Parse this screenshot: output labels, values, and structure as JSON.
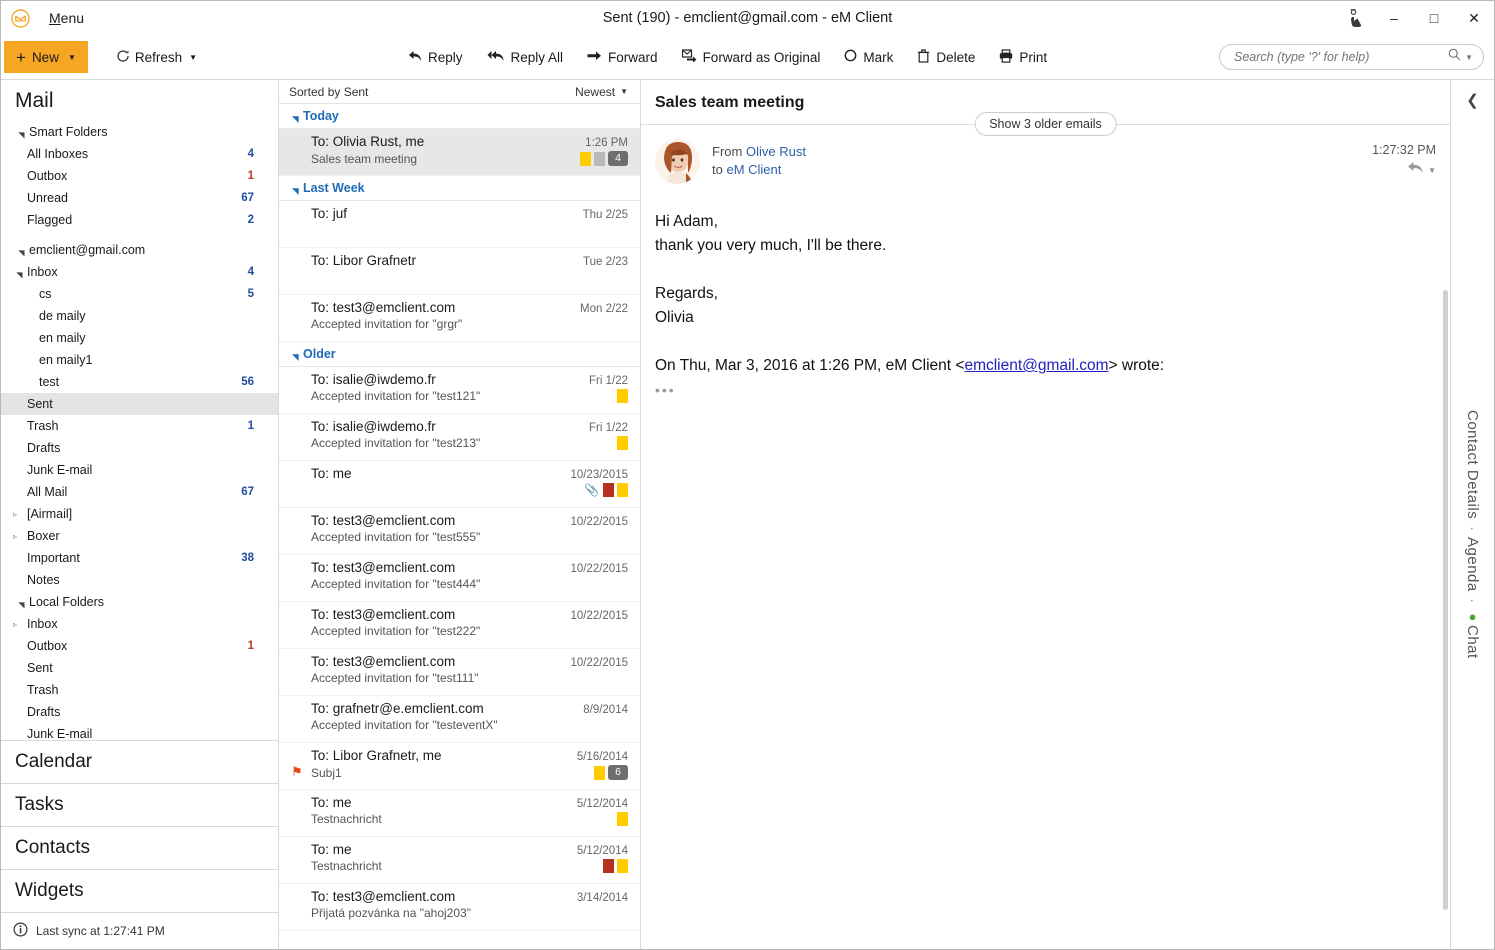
{
  "window": {
    "title": "Sent (190) - emclient@gmail.com - eM Client",
    "menu_label": "Menu",
    "logo_icon": "envelope-icon",
    "touch_icon": "touch-pointer-icon",
    "minimize_label": "–",
    "maximize_label": "□",
    "close_label": "✕"
  },
  "toolbar": {
    "new_label": "New",
    "refresh_label": "Refresh",
    "actions": [
      {
        "label": "Reply",
        "icon": "reply-arrow-icon"
      },
      {
        "label": "Reply All",
        "icon": "reply-all-arrow-icon"
      },
      {
        "label": "Forward",
        "icon": "forward-arrow-icon"
      },
      {
        "label": "Forward as Original",
        "icon": "forward-original-icon"
      },
      {
        "label": "Mark",
        "icon": "mark-circle-icon"
      },
      {
        "label": "Delete",
        "icon": "trash-icon"
      },
      {
        "label": "Print",
        "icon": "printer-icon"
      }
    ],
    "search": {
      "placeholder": "Search (type '?' for help)",
      "value": "",
      "icon": "search-icon",
      "dropdown_icon": "chevron-down-icon"
    }
  },
  "sidebar": {
    "title": "Mail",
    "groups": [
      {
        "label": "Smart Folders",
        "expanded": true,
        "items": [
          {
            "label": "All Inboxes",
            "count": "4",
            "indent": 1
          },
          {
            "label": "Outbox",
            "count": "1",
            "count_color": "red",
            "indent": 1
          },
          {
            "label": "Unread",
            "count": "67",
            "indent": 1
          },
          {
            "label": "Flagged",
            "count": "2",
            "indent": 1
          }
        ]
      },
      {
        "label": "emclient@gmail.com",
        "expanded": true,
        "items": [
          {
            "label": "Inbox",
            "count": "4",
            "indent": 1,
            "tri": "expanded"
          },
          {
            "label": "cs",
            "count": "5",
            "indent": 2
          },
          {
            "label": "de maily",
            "count": "",
            "indent": 2
          },
          {
            "label": "en maily",
            "count": "",
            "indent": 2
          },
          {
            "label": "en maily1",
            "count": "",
            "indent": 2
          },
          {
            "label": "test",
            "count": "56",
            "indent": 2
          },
          {
            "label": "Sent",
            "count": "",
            "indent": 1,
            "selected": true
          },
          {
            "label": "Trash",
            "count": "1",
            "indent": 1
          },
          {
            "label": "Drafts",
            "count": "",
            "indent": 1
          },
          {
            "label": "Junk E-mail",
            "count": "",
            "indent": 1
          },
          {
            "label": "All Mail",
            "count": "67",
            "indent": 1
          },
          {
            "label": "[Airmail]",
            "count": "",
            "indent": 1,
            "tri": "collapsed"
          },
          {
            "label": "Boxer",
            "count": "",
            "indent": 1,
            "tri": "collapsed"
          },
          {
            "label": "Important",
            "count": "38",
            "indent": 1
          },
          {
            "label": "Notes",
            "count": "",
            "indent": 1
          }
        ]
      },
      {
        "label": "Local Folders",
        "expanded": true,
        "items": [
          {
            "label": "Inbox",
            "count": "",
            "indent": 1,
            "tri": "collapsed"
          },
          {
            "label": "Outbox",
            "count": "1",
            "count_color": "red",
            "indent": 1
          },
          {
            "label": "Sent",
            "count": "",
            "indent": 1
          },
          {
            "label": "Trash",
            "count": "",
            "indent": 1
          },
          {
            "label": "Drafts",
            "count": "",
            "indent": 1
          },
          {
            "label": "Junk E-mail",
            "count": "",
            "indent": 1
          }
        ]
      }
    ],
    "nav": [
      {
        "label": "Calendar"
      },
      {
        "label": "Tasks"
      },
      {
        "label": "Contacts"
      },
      {
        "label": "Widgets"
      }
    ],
    "status": {
      "icon": "info-icon",
      "text": "Last sync at 1:27:41 PM"
    }
  },
  "msglist": {
    "sorted_by": "Sorted by Sent",
    "order": "Newest",
    "order_icon": "chevron-down-icon",
    "groups": [
      {
        "label": "Today",
        "messages": [
          {
            "to": "To: Olivia Rust, me",
            "date": "1:26 PM",
            "subject": "Sales team meeting",
            "selected": true,
            "swatches": [
              "#ffcc00",
              "#b9b9b9"
            ],
            "badge": "4"
          }
        ]
      },
      {
        "label": "Last Week",
        "messages": [
          {
            "to": "To: juf",
            "date": "Thu 2/25",
            "subject": ""
          },
          {
            "to": "To: Libor Grafnetr",
            "date": "Tue 2/23",
            "subject": ""
          },
          {
            "to": "To: test3@emclient.com",
            "date": "Mon 2/22",
            "subject": "Accepted invitation for \"grgr\""
          }
        ]
      },
      {
        "label": "Older",
        "messages": [
          {
            "to": "To: isalie@iwdemo.fr",
            "date": "Fri 1/22",
            "subject": "Accepted invitation for \"test121\"",
            "swatches": [
              "#ffcc00"
            ]
          },
          {
            "to": "To: isalie@iwdemo.fr",
            "date": "Fri 1/22",
            "subject": "Accepted invitation for \"test213\"",
            "swatches": [
              "#ffcc00"
            ]
          },
          {
            "to": "To: me",
            "date": "10/23/2015",
            "subject": "",
            "attachment": true,
            "swatches": [
              "#b5331e",
              "#ffcc00"
            ]
          },
          {
            "to": "To: test3@emclient.com",
            "date": "10/22/2015",
            "subject": "Accepted invitation for \"test555\""
          },
          {
            "to": "To: test3@emclient.com",
            "date": "10/22/2015",
            "subject": "Accepted invitation for \"test444\""
          },
          {
            "to": "To: test3@emclient.com",
            "date": "10/22/2015",
            "subject": "Accepted invitation for \"test222\""
          },
          {
            "to": "To: test3@emclient.com",
            "date": "10/22/2015",
            "subject": "Accepted invitation for \"test111\""
          },
          {
            "to": "To: grafnetr@e.emclient.com",
            "date": "8/9/2014",
            "subject": "Accepted invitation for \"testeventX\""
          },
          {
            "to": "To: Libor Grafnetr, me",
            "date": "5/16/2014",
            "subject": "Subj1",
            "flagged": true,
            "swatches": [
              "#ffcc00"
            ],
            "badge": "6"
          },
          {
            "to": "To: me",
            "date": "5/12/2014",
            "subject": "Testnachricht",
            "swatches": [
              "#ffcc00"
            ]
          },
          {
            "to": "To: me",
            "date": "5/12/2014",
            "subject": "Testnachricht",
            "swatches": [
              "#b5331e",
              "#ffcc00"
            ]
          },
          {
            "to": "To: test3@emclient.com",
            "date": "3/14/2014",
            "subject": "Přijatá pozvánka na \"ahoj203\""
          }
        ]
      }
    ]
  },
  "reader": {
    "subject": "Sales team meeting",
    "older_pill": "Show 3 older emails",
    "avatar_icon": "contact-photo-avatar",
    "from_prefix": "From",
    "from_name": "Olive Rust",
    "to_prefix": "to",
    "to_name": "eM Client",
    "time": "1:27:32 PM",
    "reply_icon": "reply-arrow-icon",
    "reply_caret_icon": "chevron-down-icon",
    "body": {
      "line1": "Hi Adam,",
      "line2": "thank you very much, I'll be there.",
      "line3": "Regards,",
      "line4": "Olivia",
      "quote_prefix": "On Thu, Mar 3, 2016 at 1:26 PM, eM Client <",
      "quote_link": "emclient@gmail.com",
      "quote_suffix": "> wrote:",
      "collapsed_dots": "•••"
    }
  },
  "rail": {
    "collapse_icon": "chevron-left-icon",
    "contact_details": "Contact Details",
    "sep": "·",
    "agenda": "Agenda",
    "chat": "Chat",
    "chat_dot_color": "#4aa82e"
  },
  "colors": {
    "accent_orange": "#f5a623",
    "link_blue": "#1f6bb8",
    "count_blue": "#1f4e9c",
    "count_red": "#c0392b"
  }
}
